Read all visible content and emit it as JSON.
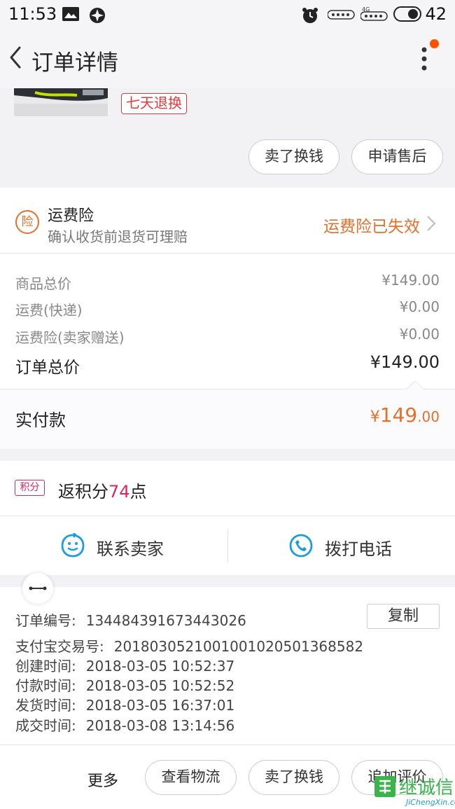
{
  "status_bar": {
    "time": "11:53",
    "battery": "42"
  },
  "header": {
    "title": "订单详情"
  },
  "product": {
    "tag": "七天退换"
  },
  "actions_top": {
    "sell": "卖了换钱",
    "after_sale": "申请售后"
  },
  "freight_insurance": {
    "icon_char": "险",
    "title": "运费险",
    "subtitle": "确认收货前退货可理赔",
    "status": "运费险已失效"
  },
  "price": {
    "rows": [
      {
        "label": "商品总价",
        "value": "¥149.00"
      },
      {
        "label": "运费(快递)",
        "value": "¥0.00"
      },
      {
        "label": "运费险(卖家赠送)",
        "value": "¥0.00"
      }
    ],
    "total_label": "订单总价",
    "total_value": "¥149.00",
    "paid_label": "实付款",
    "paid_currency": "¥",
    "paid_int": "149",
    "paid_dec": ".00"
  },
  "points": {
    "badge": "积分",
    "prefix": "返积分",
    "amount": "74",
    "suffix": "点"
  },
  "contact": {
    "seller": "联系卖家",
    "phone": "拨打电话"
  },
  "order_info": {
    "copy_label": "复制",
    "lines": [
      {
        "label": "订单编号:",
        "value": "134484391673443026"
      },
      {
        "label": "支付宝交易号:",
        "value": "2018030521001001020501368582"
      },
      {
        "label": "创建时间:",
        "value": "2018-03-05 10:52:37"
      },
      {
        "label": "付款时间:",
        "value": "2018-03-05 10:52:52"
      },
      {
        "label": "发货时间:",
        "value": "2018-03-05 16:37:01"
      },
      {
        "label": "成交时间:",
        "value": "2018-03-08 13:14:56"
      }
    ]
  },
  "bottom_bar": {
    "more": "更多",
    "logistics": "查看物流",
    "sell": "卖了换钱",
    "review": "追加评价"
  },
  "watermark": {
    "text": "继诚信",
    "sub": "JiChengXin.com"
  },
  "colors": {
    "accent_orange": "#e4702c",
    "accent_red": "#e4393c",
    "points_pink": "#e0245e",
    "contact_blue": "#1a9de0"
  }
}
